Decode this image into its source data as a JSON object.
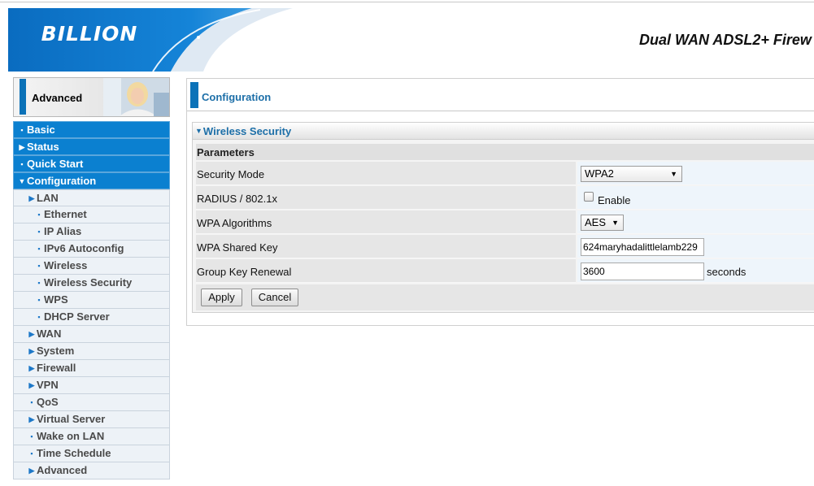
{
  "header": {
    "logo": "BILLION",
    "product_title": "Dual WAN ADSL2+ Firew"
  },
  "mode_banner": {
    "label": "Advanced"
  },
  "sidebar": {
    "main_items": [
      {
        "label": "Basic",
        "icon": "bullet"
      },
      {
        "label": "Status",
        "icon": "triangle-right"
      },
      {
        "label": "Quick Start",
        "icon": "bullet"
      },
      {
        "label": "Configuration",
        "icon": "triangle-down"
      }
    ],
    "sub_items": [
      {
        "label": "LAN",
        "icon": "triangle-right",
        "level": 2
      },
      {
        "label": "Ethernet",
        "icon": "bullet",
        "level": 3
      },
      {
        "label": "IP Alias",
        "icon": "bullet",
        "level": 3
      },
      {
        "label": "IPv6 Autoconfig",
        "icon": "bullet",
        "level": 3
      },
      {
        "label": "Wireless",
        "icon": "bullet",
        "level": 3
      },
      {
        "label": "Wireless Security",
        "icon": "bullet",
        "level": 3
      },
      {
        "label": "WPS",
        "icon": "bullet",
        "level": 3
      },
      {
        "label": "DHCP Server",
        "icon": "bullet",
        "level": 3
      },
      {
        "label": "WAN",
        "icon": "triangle-right",
        "level": 2
      },
      {
        "label": "System",
        "icon": "triangle-right",
        "level": 2
      },
      {
        "label": "Firewall",
        "icon": "triangle-right",
        "level": 2
      },
      {
        "label": "VPN",
        "icon": "triangle-right",
        "level": 2
      },
      {
        "label": "QoS",
        "icon": "bullet",
        "level": 2
      },
      {
        "label": "Virtual Server",
        "icon": "triangle-right",
        "level": 2
      },
      {
        "label": "Wake on LAN",
        "icon": "bullet",
        "level": 2
      },
      {
        "label": "Time Schedule",
        "icon": "bullet",
        "level": 2
      },
      {
        "label": "Advanced",
        "icon": "triangle-right",
        "level": 2
      }
    ]
  },
  "main": {
    "page_title": "Configuration",
    "section_title": "Wireless Security",
    "params_header": "Parameters",
    "fields": {
      "security_mode": {
        "label": "Security Mode",
        "value": "WPA2"
      },
      "radius": {
        "label": "RADIUS / 802.1x",
        "checkbox_label": "Enable",
        "checked": false
      },
      "wpa_algorithms": {
        "label": "WPA Algorithms",
        "value": "AES"
      },
      "wpa_shared_key": {
        "label": "WPA Shared Key",
        "value": "624maryhadalittlelamb229"
      },
      "group_key_renewal": {
        "label": "Group Key Renewal",
        "value": "3600",
        "unit": "seconds"
      }
    },
    "buttons": {
      "apply": "Apply",
      "cancel": "Cancel"
    }
  },
  "colors": {
    "brand_blue": "#0b72b8",
    "nav_blue": "#0b80d0",
    "title_blue": "#1d6fa8"
  }
}
